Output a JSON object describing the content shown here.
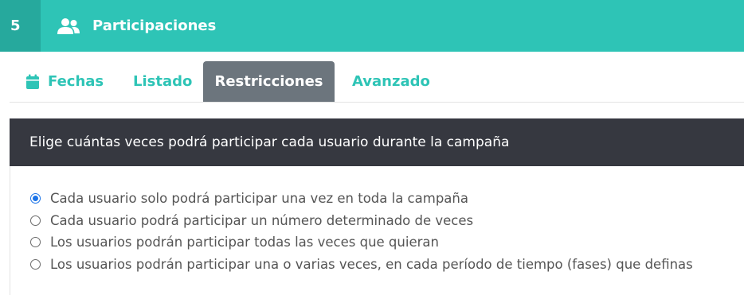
{
  "header": {
    "step_number": "5",
    "icon": "users-icon",
    "title": "Participaciones",
    "color": "#2ec4b6"
  },
  "tabs": [
    {
      "label": "Fechas",
      "icon": "calendar-icon",
      "active": false
    },
    {
      "label": "Listado",
      "active": false
    },
    {
      "label": "Restricciones",
      "active": true
    },
    {
      "label": "Avanzado",
      "active": false
    }
  ],
  "section": {
    "title": "Elige cuántas veces podrá participar cada usuario durante la campaña"
  },
  "options": [
    {
      "label": "Cada usuario solo podrá participar una vez en toda la campaña",
      "selected": true
    },
    {
      "label": "Cada usuario podrá participar un número determinado de veces",
      "selected": false
    },
    {
      "label": "Los usuarios podrán participar todas las veces que quieran",
      "selected": false
    },
    {
      "label": "Los usuarios podrán participar una o varias veces, en cada período de tiempo (fases) que definas",
      "selected": false
    }
  ]
}
